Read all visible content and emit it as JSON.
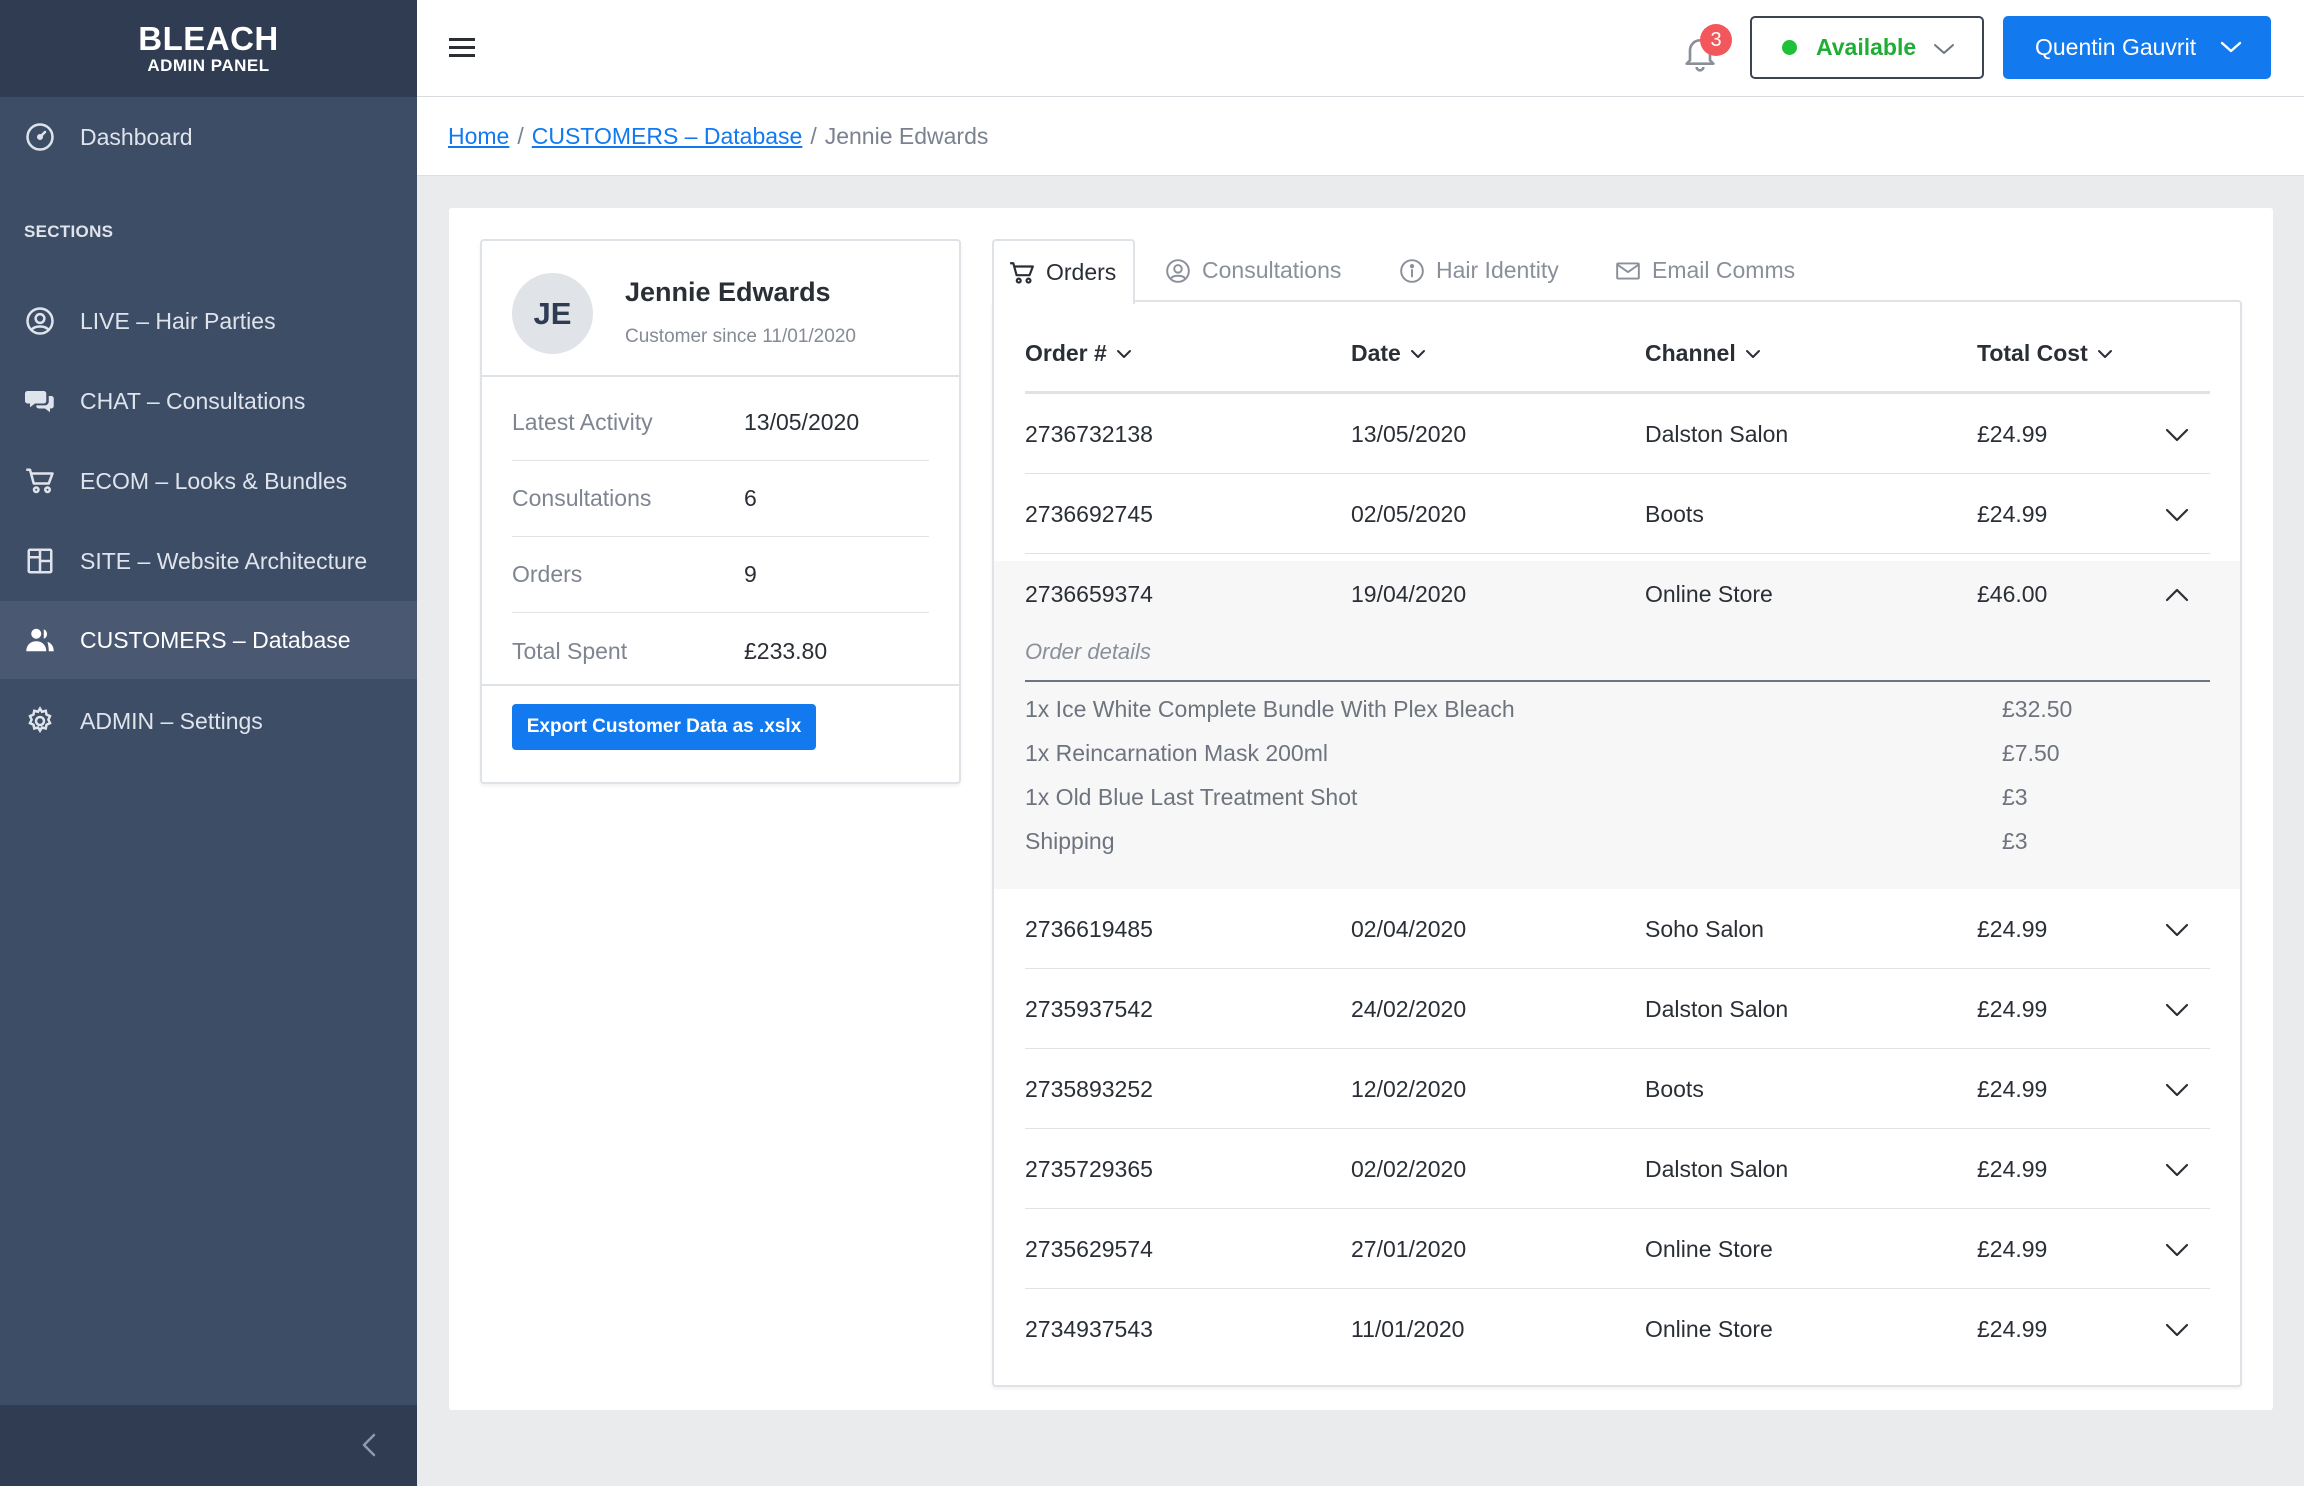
{
  "brand": {
    "title": "BLEACH",
    "subtitle": "ADMIN PANEL"
  },
  "sidebar": {
    "dashboard": {
      "label": "Dashboard",
      "icon": "dashboard-gauge-icon"
    },
    "sections_label": "SECTIONS",
    "items": [
      {
        "label": "LIVE – Hair Parties",
        "icon": "user-circle-icon"
      },
      {
        "label": "CHAT – Consultations",
        "icon": "chat-bubbles-icon"
      },
      {
        "label": "ECOM – Looks & Bundles",
        "icon": "cart-icon"
      },
      {
        "label": "SITE – Website Architecture",
        "icon": "layout-icon"
      },
      {
        "label": "CUSTOMERS – Database",
        "icon": "users-icon",
        "active": true
      },
      {
        "label": "ADMIN – Settings",
        "icon": "gear-icon"
      }
    ]
  },
  "topbar": {
    "notification_count": "3",
    "status_label": "Available",
    "user_name": "Quentin Gauvrit"
  },
  "breadcrumb": {
    "home": "Home",
    "section": "CUSTOMERS – Database",
    "current": "Jennie Edwards",
    "separator": "/"
  },
  "customer": {
    "initials": "JE",
    "name": "Jennie Edwards",
    "since": "Customer since 11/01/2020",
    "stats": [
      {
        "label": "Latest Activity",
        "value": "13/05/2020"
      },
      {
        "label": "Consultations",
        "value": "6"
      },
      {
        "label": "Orders",
        "value": "9"
      },
      {
        "label": "Total Spent",
        "value": "£233.80"
      }
    ],
    "export_label": "Export Customer Data as .xslx"
  },
  "tabs": [
    {
      "label": "Orders",
      "icon": "cart-icon",
      "active": true
    },
    {
      "label": "Consultations",
      "icon": "user-circle-icon"
    },
    {
      "label": "Hair Identity",
      "icon": "info-circle-icon"
    },
    {
      "label": "Email Comms",
      "icon": "envelope-icon"
    }
  ],
  "orders": {
    "columns": [
      "Order #",
      "Date",
      "Channel",
      "Total Cost"
    ],
    "rows": [
      {
        "order": "2736732138",
        "date": "13/05/2020",
        "channel": "Dalston Salon",
        "total": "£24.99"
      },
      {
        "order": "2736692745",
        "date": "02/05/2020",
        "channel": "Boots",
        "total": "£24.99"
      },
      {
        "order": "2736659374",
        "date": "19/04/2020",
        "channel": "Online Store",
        "total": "£46.00",
        "expanded": true
      },
      {
        "order": "2736619485",
        "date": "02/04/2020",
        "channel": "Soho Salon",
        "total": "£24.99"
      },
      {
        "order": "2735937542",
        "date": "24/02/2020",
        "channel": "Dalston Salon",
        "total": "£24.99"
      },
      {
        "order": "2735893252",
        "date": "12/02/2020",
        "channel": "Boots",
        "total": "£24.99"
      },
      {
        "order": "2735729365",
        "date": "02/02/2020",
        "channel": "Dalston Salon",
        "total": "£24.99"
      },
      {
        "order": "2735629574",
        "date": "27/01/2020",
        "channel": "Online Store",
        "total": "£24.99"
      },
      {
        "order": "2734937543",
        "date": "11/01/2020",
        "channel": "Online Store",
        "total": "£24.99"
      }
    ],
    "details": {
      "label": "Order details",
      "items": [
        {
          "name": "1x Ice White Complete Bundle With Plex Bleach",
          "price": "£32.50"
        },
        {
          "name": "1x Reincarnation Mask 200ml",
          "price": "£7.50"
        },
        {
          "name": "1x Old Blue Last Treatment Shot",
          "price": "£3"
        },
        {
          "name": "Shipping",
          "price": "£3"
        }
      ]
    }
  },
  "colors": {
    "sidebar_bg": "#3e4d66",
    "sidebar_dark": "#2f3c52",
    "accent_blue": "#1279ef",
    "status_green": "#1fae35",
    "badge_red": "#f2575c"
  }
}
